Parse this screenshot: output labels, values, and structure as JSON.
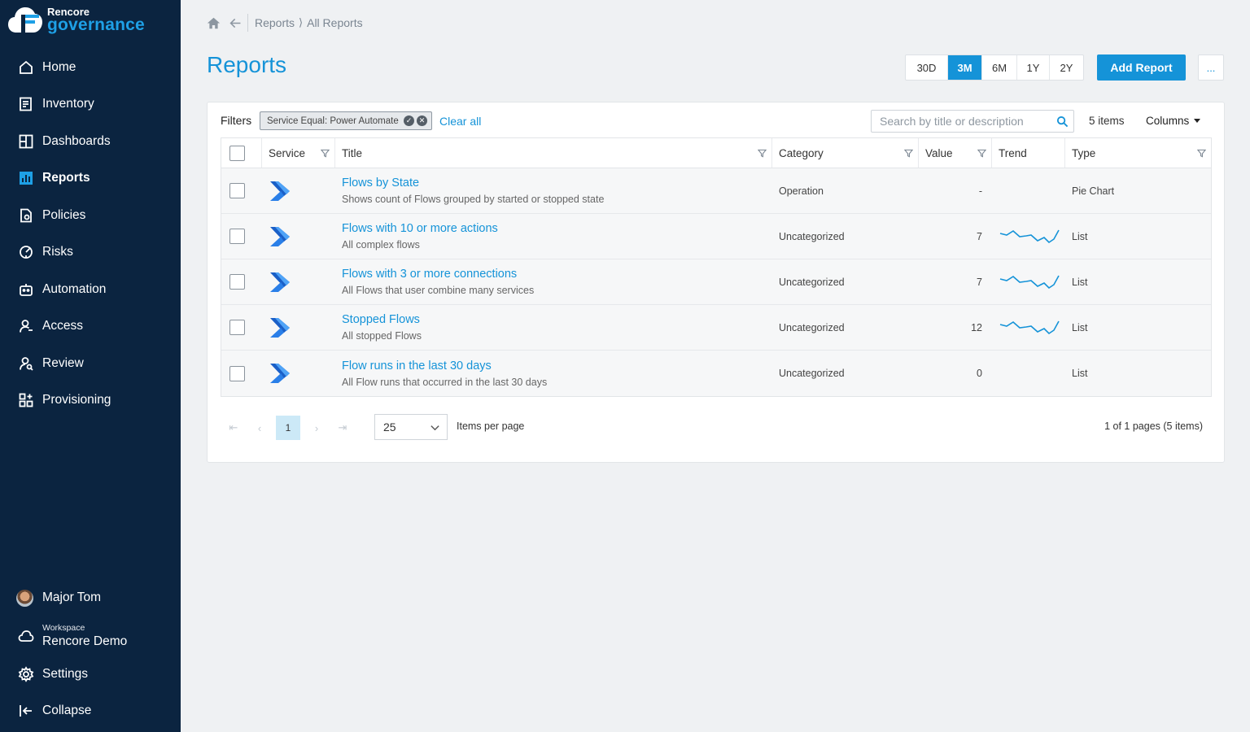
{
  "app": {
    "logo_line1": "Rencore",
    "logo_line2": "governance",
    "brand_color": "#1593d8",
    "sidebar_color": "#0b2440"
  },
  "nav": [
    {
      "label": "Home",
      "icon": "home-icon"
    },
    {
      "label": "Inventory",
      "icon": "inventory-icon"
    },
    {
      "label": "Dashboards",
      "icon": "dashboards-icon"
    },
    {
      "label": "Reports",
      "icon": "reports-icon",
      "active": true
    },
    {
      "label": "Policies",
      "icon": "policies-icon"
    },
    {
      "label": "Risks",
      "icon": "risks-icon"
    },
    {
      "label": "Automation",
      "icon": "automation-icon"
    },
    {
      "label": "Access",
      "icon": "access-icon"
    },
    {
      "label": "Review",
      "icon": "review-icon"
    },
    {
      "label": "Provisioning",
      "icon": "provisioning-icon"
    }
  ],
  "bottom": {
    "user_name": "Major Tom",
    "workspace_label": "Workspace",
    "workspace_name": "Rencore Demo",
    "settings_label": "Settings",
    "collapse_label": "Collapse"
  },
  "breadcrumb": {
    "parent": "Reports",
    "current": "All Reports"
  },
  "page": {
    "title": "Reports",
    "periods": [
      "30D",
      "3M",
      "6M",
      "1Y",
      "2Y"
    ],
    "active_period": "3M",
    "add_label": "Add Report",
    "more_label": "..."
  },
  "toolbar": {
    "filters_label": "Filters",
    "chip_label": "Service Equal: Power Automate",
    "clear_all": "Clear all",
    "search_placeholder": "Search by title or description",
    "items_count": "5 items",
    "columns_label": "Columns"
  },
  "table": {
    "columns": [
      "Service",
      "Title",
      "Category",
      "Value",
      "Trend",
      "Type"
    ],
    "rows": [
      {
        "title": "Flows by State",
        "description": "Shows count of Flows grouped by started or stopped state",
        "category": "Operation",
        "value": "-",
        "trend": false,
        "type": "Pie Chart"
      },
      {
        "title": "Flows with 10 or more actions",
        "description": "All complex flows",
        "category": "Uncategorized",
        "value": "7",
        "trend": true,
        "type": "List"
      },
      {
        "title": "Flows with 3 or more connections",
        "description": "All Flows that user combine many services",
        "category": "Uncategorized",
        "value": "7",
        "trend": true,
        "type": "List"
      },
      {
        "title": "Stopped Flows",
        "description": "All stopped Flows",
        "category": "Uncategorized",
        "value": "12",
        "trend": true,
        "type": "List"
      },
      {
        "title": "Flow runs in the last 30 days",
        "description": "All Flow runs that occurred in the last 30 days",
        "category": "Uncategorized",
        "value": "0",
        "trend": false,
        "type": "List"
      }
    ]
  },
  "pagination": {
    "current_page": "1",
    "per_page": "25",
    "per_page_label": "Items per page",
    "info": "1 of 1 pages (5 items)"
  }
}
